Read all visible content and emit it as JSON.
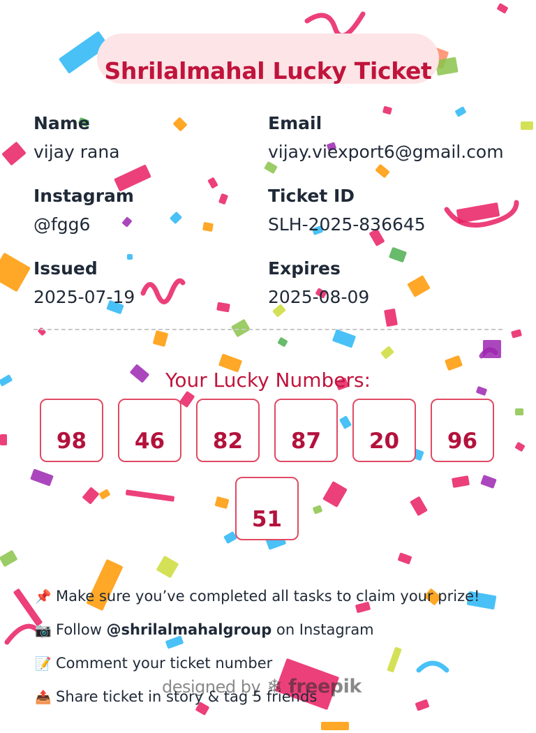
{
  "ticket": {
    "title": "Shrilalmahal Lucky Ticket",
    "fields": {
      "name": {
        "label": "Name",
        "value": "vijay rana"
      },
      "email": {
        "label": "Email",
        "value": "vijay.viexport6@gmail.com"
      },
      "instagram": {
        "label": "Instagram",
        "value": "@fgg6"
      },
      "ticket_id": {
        "label": "Ticket ID",
        "value": "SLH-2025-836645"
      },
      "issued": {
        "label": "Issued",
        "value": "2025-07-19"
      },
      "expires": {
        "label": "Expires",
        "value": "2025-08-09"
      }
    },
    "lucky_heading": "Your Lucky Numbers:",
    "lucky_numbers": [
      "98",
      "46",
      "82",
      "87",
      "20",
      "96",
      "51"
    ],
    "instructions": {
      "line1": {
        "icon": "pushpin-icon",
        "text": "Make sure you’ve completed all tasks to claim your prize!"
      },
      "line2": {
        "icon": "camera-icon",
        "prefix": "Follow ",
        "handle": "@shrilalmahalgroup",
        "suffix": " on Instagram"
      },
      "line3": {
        "icon": "memo-icon",
        "text": "Comment your ticket number"
      },
      "line4": {
        "icon": "outbox-tray-icon",
        "text": "Share ticket in story & tag 5 friends"
      }
    },
    "watermark": {
      "prefix": "designed by",
      "brand": "freepik"
    }
  },
  "colors": {
    "accent": "#c0143c",
    "pill_bg": "#fde4e6",
    "number_border": "#e04a63"
  }
}
